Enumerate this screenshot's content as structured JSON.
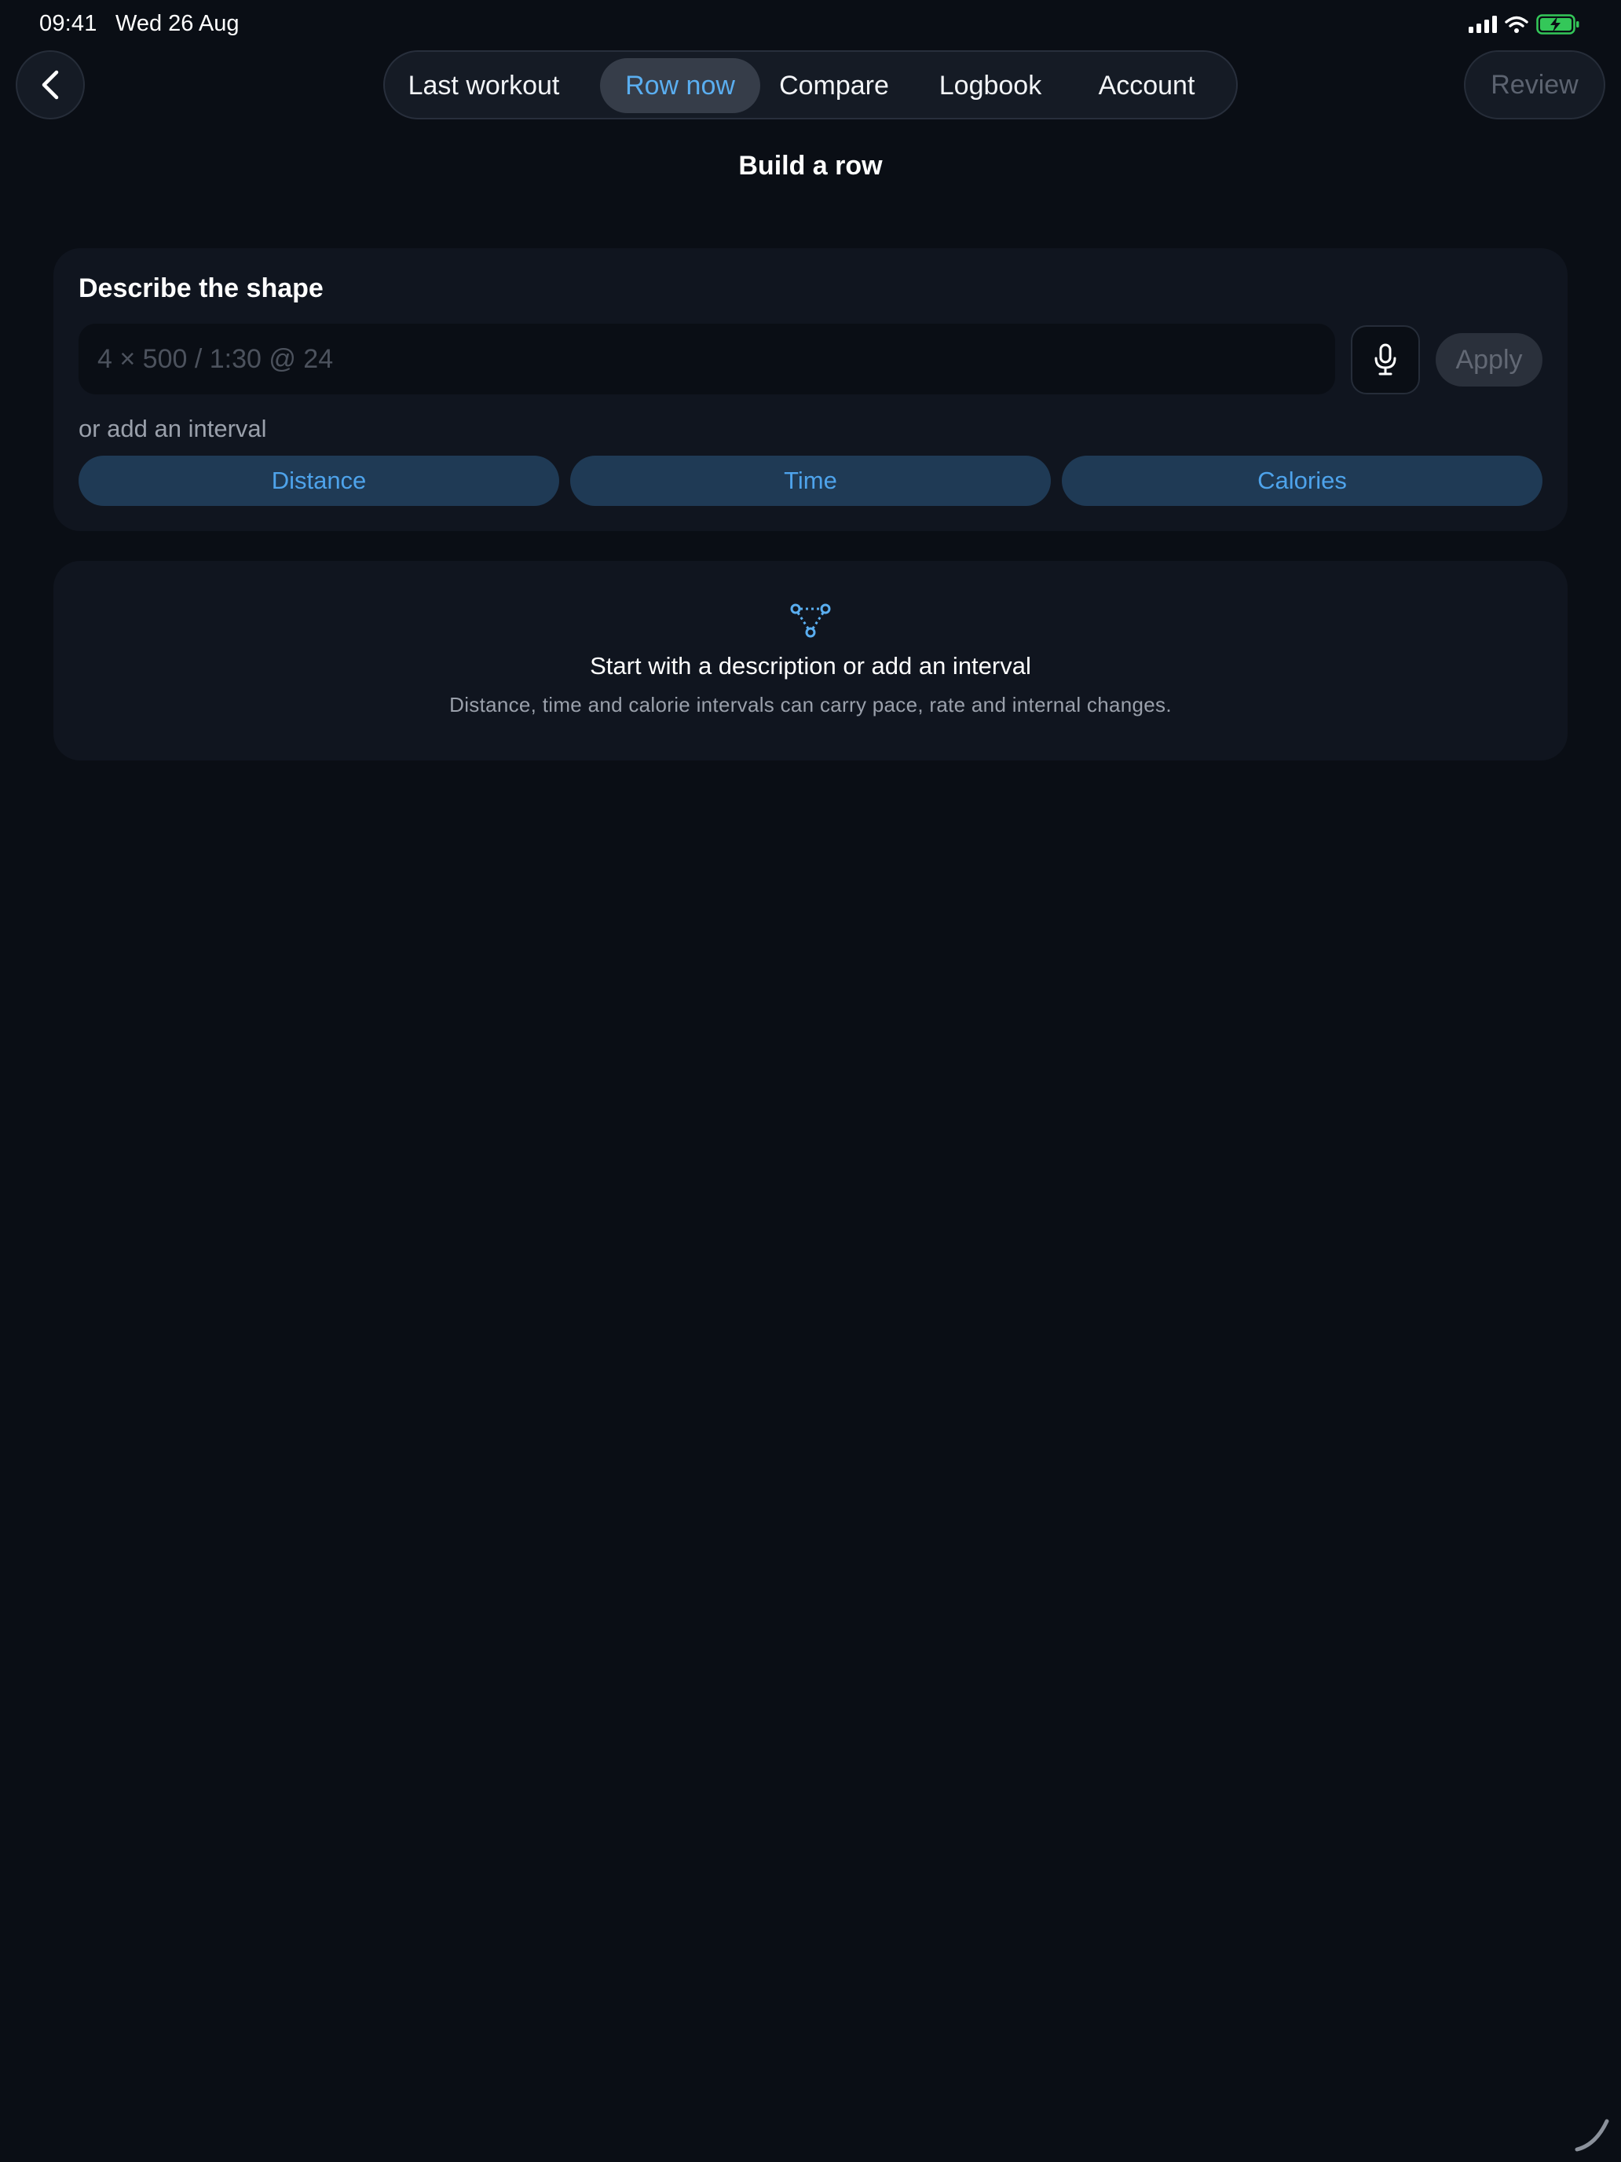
{
  "status_bar": {
    "time": "09:41",
    "date": "Wed 26 Aug",
    "icons": [
      "cellular-signal-icon",
      "wifi-icon",
      "battery-charging-icon"
    ]
  },
  "nav": {
    "back_icon": "chevron-left-icon",
    "tabs": [
      {
        "label": "Last workout",
        "active": false
      },
      {
        "label": "Row now",
        "active": true
      },
      {
        "label": "Compare",
        "active": false
      },
      {
        "label": "Logbook",
        "active": false
      },
      {
        "label": "Account",
        "active": false
      }
    ],
    "review_label": "Review"
  },
  "page": {
    "title": "Build a row"
  },
  "shape_card": {
    "label": "Describe the shape",
    "input_value": "",
    "input_placeholder": "4 × 500 / 1:30 @ 24",
    "mic_icon": "microphone-icon",
    "apply_label": "Apply",
    "interval_hint": "or add an interval",
    "interval_buttons": [
      "Distance",
      "Time",
      "Calories"
    ]
  },
  "empty_state": {
    "icon": "interval-tree-icon",
    "title": "Start with a description or add an interval",
    "subtitle": "Distance, time and calorie intervals can carry pace, rate and internal changes."
  },
  "colors": {
    "background": "#0a0e15",
    "card": "#10151f",
    "accent": "#5aaef0",
    "interval_button_bg": "#1f3a55",
    "interval_button_text": "#4ea3eb",
    "battery_green": "#34c759"
  }
}
